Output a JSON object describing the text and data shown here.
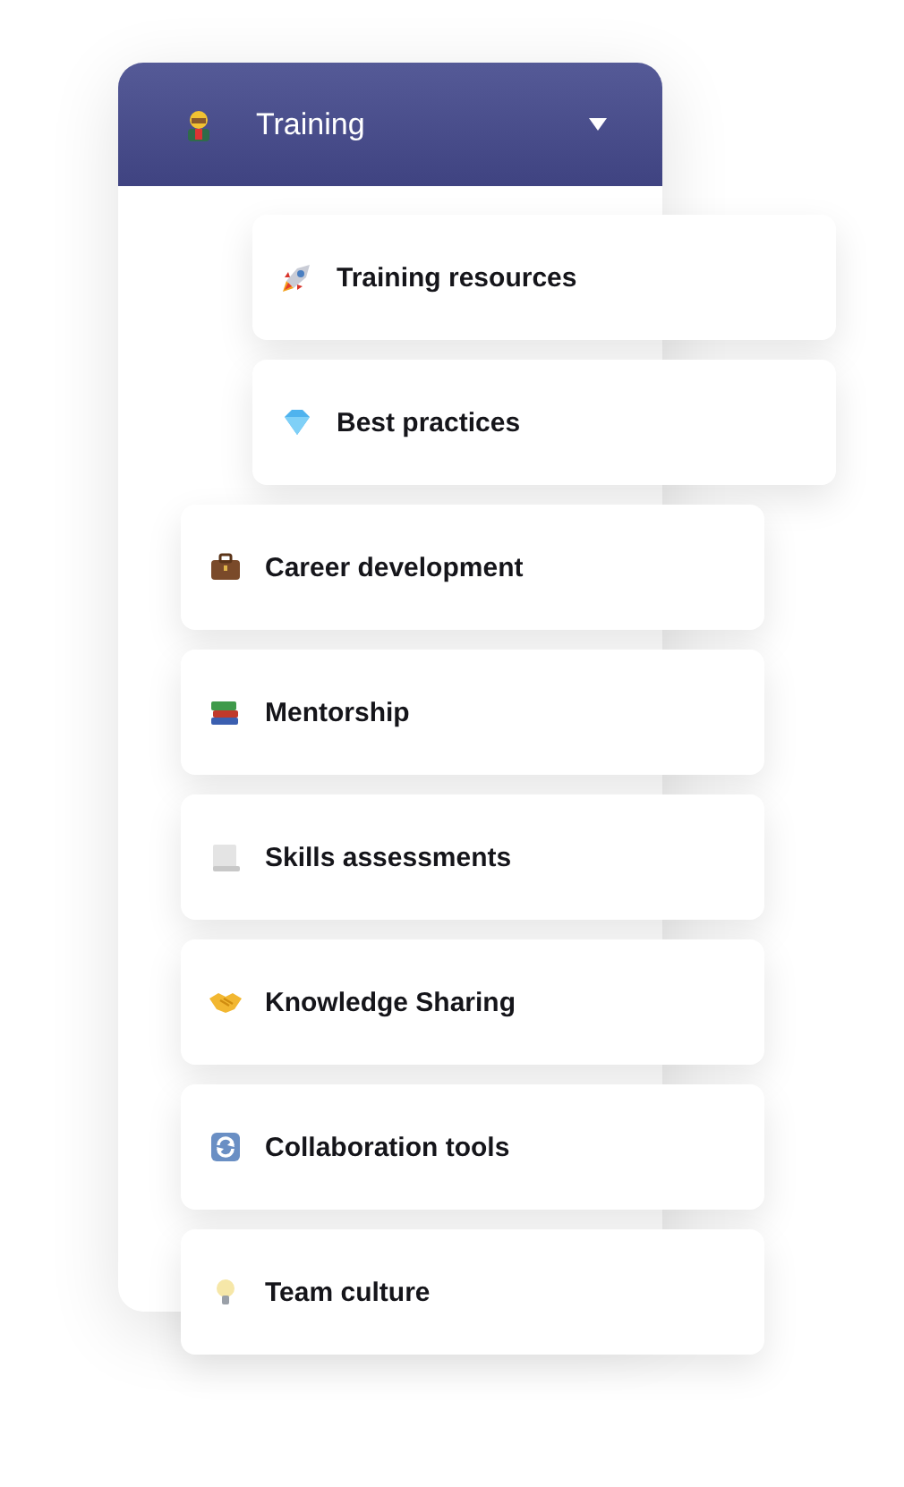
{
  "dropdown": {
    "title": "Training",
    "expanded": true
  },
  "items": [
    {
      "label": "Training resources",
      "kind": "shifted"
    },
    {
      "label": "Best practices",
      "kind": "shifted"
    },
    {
      "label": "Career development",
      "kind": "plain"
    },
    {
      "label": "Mentorship",
      "kind": "plain"
    },
    {
      "label": "Skills assessments",
      "kind": "plain"
    },
    {
      "label": "Knowledge Sharing",
      "kind": "plain"
    },
    {
      "label": "Collaboration tools",
      "kind": "plain"
    },
    {
      "label": "Team culture",
      "kind": "plain"
    }
  ]
}
